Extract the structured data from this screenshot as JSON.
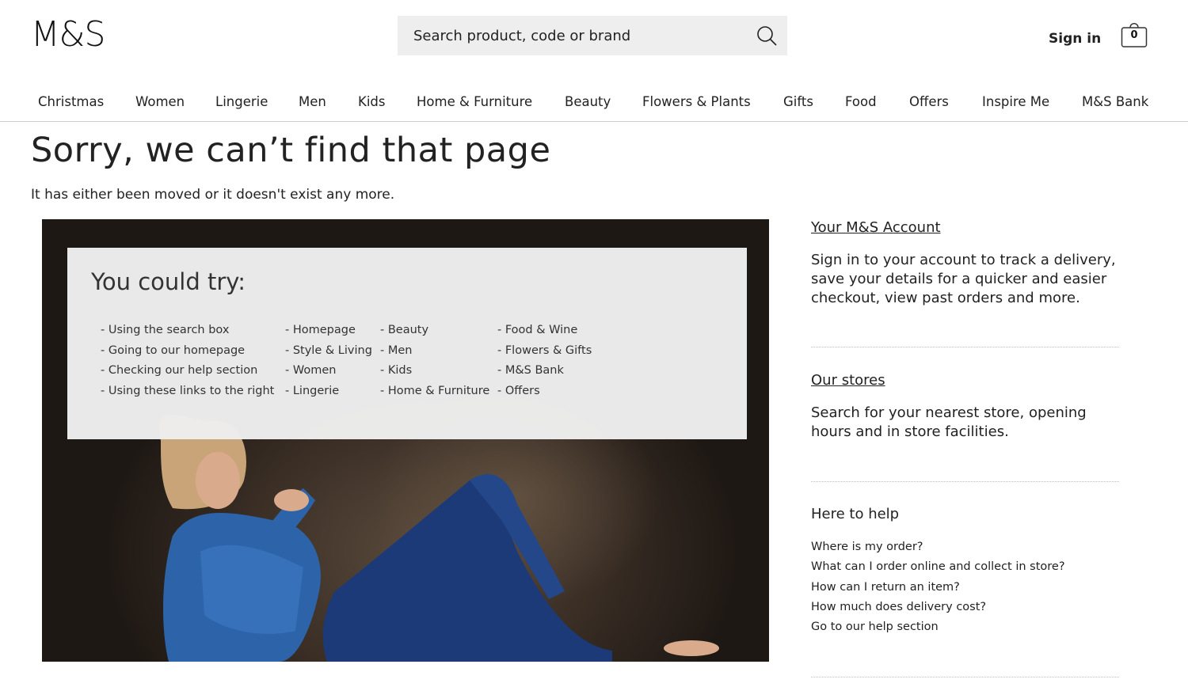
{
  "header": {
    "logo": "M&S",
    "search_placeholder": "Search product, code or brand",
    "sign_in": "Sign in",
    "bag_count": "0"
  },
  "nav": [
    "Christmas",
    "Women",
    "Lingerie",
    "Men",
    "Kids",
    "Home & Furniture",
    "Beauty",
    "Flowers & Plants",
    "Gifts",
    "Food",
    "Offers",
    "Inspire Me",
    "M&S Bank"
  ],
  "page": {
    "title": "Sorry, we can’t find that page",
    "subtitle": "It has either been moved or it doesn't exist any more."
  },
  "try_box": {
    "title": "You could try:",
    "columns": [
      [
        "- Using the search box",
        "- Going to our homepage",
        "- Checking our help section",
        "- Using these links to the right"
      ],
      [
        "- Homepage",
        "- Style & Living",
        "- Women",
        "- Lingerie"
      ],
      [
        "- Beauty",
        "- Men",
        "- Kids",
        "- Home & Furniture"
      ],
      [
        "- Food & Wine",
        "- Flowers & Gifts",
        "- M&S Bank",
        "- Offers"
      ]
    ]
  },
  "sidebar": {
    "account": {
      "link": "Your M&S Account",
      "text": "Sign in to your account to track a delivery, save your details for a quicker and easier checkout, view past orders and more."
    },
    "stores": {
      "link": "Our stores",
      "text": "Search for your nearest store, opening hours and in store facilities."
    },
    "help": {
      "title": "Here to help",
      "links": [
        "Where is my order?",
        "What can I order online and collect in store?",
        "How can I return an item?",
        "How much does delivery cost?",
        "Go to our help section"
      ]
    }
  }
}
